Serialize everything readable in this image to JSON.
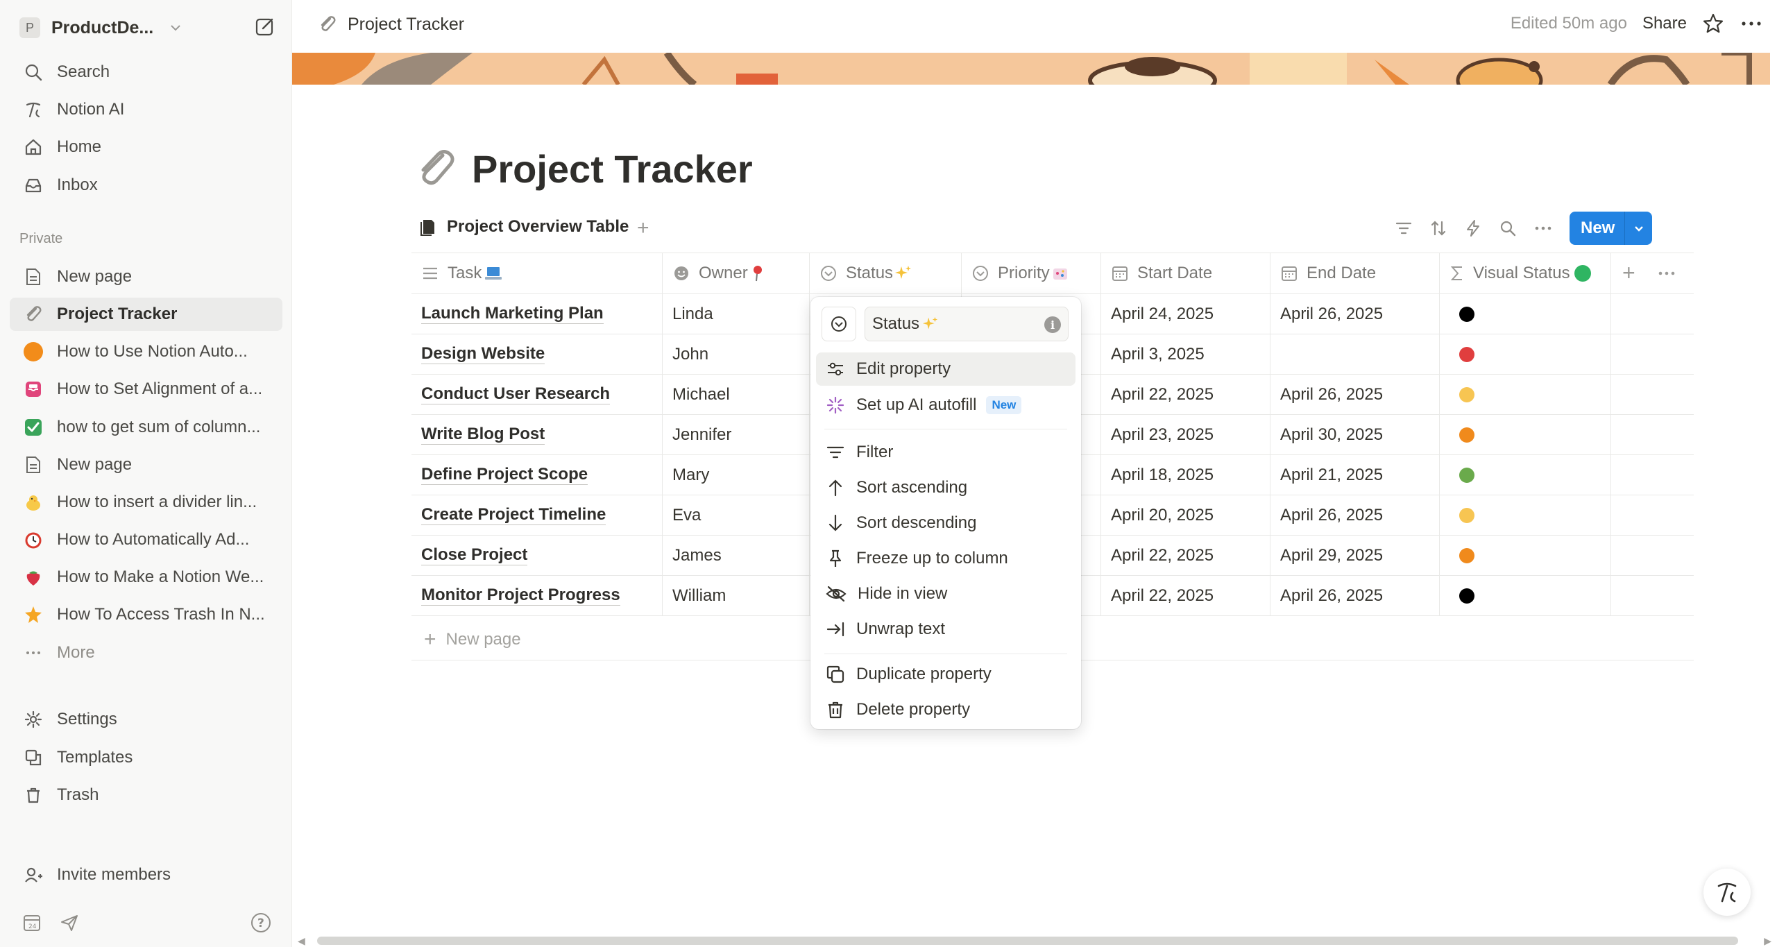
{
  "workspace": {
    "avatar_letter": "P",
    "name": "ProductDe..."
  },
  "sidebar": {
    "top_items": [
      {
        "label": "Search",
        "icon": "search-icon"
      },
      {
        "label": "Notion AI",
        "icon": "notion-ai-icon"
      },
      {
        "label": "Home",
        "icon": "home-icon"
      },
      {
        "label": "Inbox",
        "icon": "inbox-icon"
      }
    ],
    "section_label": "Private",
    "pages": [
      {
        "label": "New page",
        "icon": "page-icon"
      },
      {
        "label": "Project Tracker",
        "icon": "paperclip-icon",
        "active": true
      },
      {
        "label": "How to Use Notion Auto...",
        "icon": "orange-circle-icon",
        "color": "#f28c1a"
      },
      {
        "label": "How to Set Alignment of a...",
        "icon": "pink-inbox-icon",
        "color": "#e0457b"
      },
      {
        "label": "how to get sum of column...",
        "icon": "check-box-icon",
        "color": "#3aa45a"
      },
      {
        "label": "New page",
        "icon": "page-icon"
      },
      {
        "label": "How to insert a divider lin...",
        "icon": "chick-icon",
        "color": "#f7c948"
      },
      {
        "label": "How to Automatically Ad...",
        "icon": "alarm-clock-icon",
        "color": "#d93a2e"
      },
      {
        "label": "How to Make a Notion We...",
        "icon": "strawberry-icon",
        "color": "#d83245"
      },
      {
        "label": "How To Access Trash In N...",
        "icon": "star-burst-icon",
        "color": "#f5a623"
      },
      {
        "label": "More",
        "icon": "more-dots-icon"
      }
    ],
    "bottom_items": [
      {
        "label": "Settings",
        "icon": "gear-icon"
      },
      {
        "label": "Templates",
        "icon": "templates-icon"
      },
      {
        "label": "Trash",
        "icon": "trash-icon"
      }
    ],
    "invite_label": "Invite members"
  },
  "topbar": {
    "breadcrumb": "Project Tracker",
    "edited": "Edited 50m ago",
    "share": "Share"
  },
  "page": {
    "title": "Project Tracker",
    "view_tab": "Project Overview Table",
    "new_button": "New"
  },
  "table": {
    "columns": [
      {
        "label": "Task",
        "icon": "lines-icon",
        "emoji": "laptop-icon"
      },
      {
        "label": "Owner",
        "icon": "person-face-icon",
        "emoji": "pin-icon"
      },
      {
        "label": "Status",
        "icon": "status-icon",
        "emoji": "sparkles-icon"
      },
      {
        "label": "Priority",
        "icon": "status-icon",
        "emoji": "party-icon"
      },
      {
        "label": "Start Date",
        "icon": "calendar-icon"
      },
      {
        "label": "End Date",
        "icon": "calendar-icon"
      },
      {
        "label": "Visual Status",
        "icon": "sigma-icon",
        "emoji": "green-circle-icon"
      }
    ],
    "rows": [
      {
        "task": "Launch Marketing Plan",
        "owner": "Linda",
        "start": "April 24, 2025",
        "end": "April 26, 2025",
        "visual": "#000000"
      },
      {
        "task": "Design Website",
        "owner": "John",
        "start": "April 3, 2025",
        "end": "",
        "visual": "#e03e3e"
      },
      {
        "task": "Conduct User Research",
        "owner": "Michael",
        "start": "April 22, 2025",
        "end": "April 26, 2025",
        "visual": "#f7c552"
      },
      {
        "task": "Write Blog Post",
        "owner": "Jennifer",
        "start": "April 23, 2025",
        "end": "April 30, 2025",
        "visual": "#f08a1c"
      },
      {
        "task": "Define Project Scope",
        "owner": "Mary",
        "start": "April 18, 2025",
        "end": "April 21, 2025",
        "visual": "#6aaa4b"
      },
      {
        "task": "Create Project Timeline",
        "owner": "Eva",
        "start": "April 20, 2025",
        "end": "April 26, 2025",
        "visual": "#f7c552"
      },
      {
        "task": "Close Project",
        "owner": "James",
        "start": "April 22, 2025",
        "end": "April 29, 2025",
        "visual": "#f08a1c"
      },
      {
        "task": "Monitor Project Progress",
        "owner": "William",
        "start": "April 22, 2025",
        "end": "April 26, 2025",
        "visual": "#000000"
      }
    ],
    "new_page_label": "New page"
  },
  "menu": {
    "field_value": "Status",
    "items": [
      {
        "label": "Edit property",
        "icon": "sliders-icon"
      },
      {
        "label": "Set up AI autofill",
        "icon": "ai-sparkle-icon",
        "badge": "New"
      },
      {
        "label": "Filter",
        "icon": "filter-icon"
      },
      {
        "label": "Sort ascending",
        "icon": "arrow-up-icon"
      },
      {
        "label": "Sort descending",
        "icon": "arrow-down-icon"
      },
      {
        "label": "Freeze up to column",
        "icon": "pin-icon"
      },
      {
        "label": "Hide in view",
        "icon": "eye-off-icon"
      },
      {
        "label": "Unwrap text",
        "icon": "unwrap-icon"
      },
      {
        "label": "Duplicate property",
        "icon": "duplicate-icon"
      },
      {
        "label": "Delete property",
        "icon": "trash-icon"
      }
    ]
  },
  "colors": {
    "accent": "#2383e2",
    "sidebar_bg": "#f8f8f7",
    "cover": "#f5c79b"
  }
}
